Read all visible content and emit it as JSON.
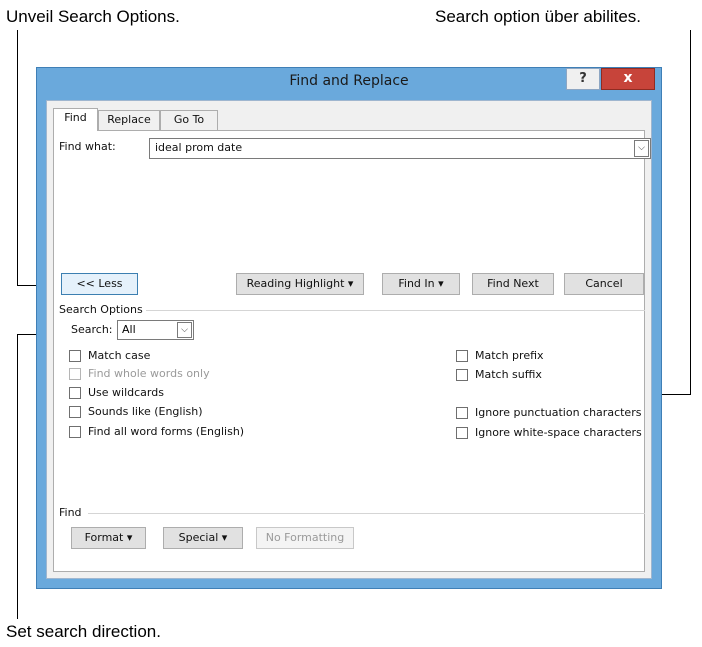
{
  "callouts": {
    "top_left": "Unveil Search Options.",
    "top_right": "Search option über abilites.",
    "bottom": "Set search direction."
  },
  "dialog": {
    "title": "Find and Replace",
    "help_label": "?",
    "close_label": "x",
    "tabs": [
      {
        "label": "Find",
        "active": true
      },
      {
        "label": "Replace",
        "active": false
      },
      {
        "label": "Go To",
        "active": false
      }
    ],
    "find_what_label": "Find what:",
    "find_what_value": "ideal prom date",
    "buttons": {
      "less": "<< Less",
      "reading_highlight": "Reading Highlight",
      "find_in": "Find In",
      "find_next": "Find Next",
      "cancel": "Cancel"
    },
    "search_options_header": "Search Options",
    "search_label": "Search:",
    "search_value": "All",
    "left_options": [
      {
        "label": "Match case",
        "enabled": true,
        "checked": false
      },
      {
        "label": "Find whole words only",
        "enabled": false,
        "checked": false
      },
      {
        "label": "Use wildcards",
        "enabled": true,
        "checked": false
      },
      {
        "label": "Sounds like (English)",
        "enabled": true,
        "checked": false
      },
      {
        "label": "Find all word forms (English)",
        "enabled": true,
        "checked": false
      }
    ],
    "right_options": [
      {
        "label": "Match prefix",
        "enabled": true,
        "checked": false
      },
      {
        "label": "Match suffix",
        "enabled": true,
        "checked": false
      },
      {
        "label": "Ignore punctuation characters",
        "enabled": true,
        "checked": false
      },
      {
        "label": "Ignore white-space characters",
        "enabled": true,
        "checked": false
      }
    ],
    "find_section_header": "Find",
    "bottom_buttons": {
      "format": "Format",
      "special": "Special",
      "no_formatting": "No Formatting"
    }
  },
  "colors": {
    "window_frame": "#6aa9dc",
    "close_button": "#c7443a"
  }
}
